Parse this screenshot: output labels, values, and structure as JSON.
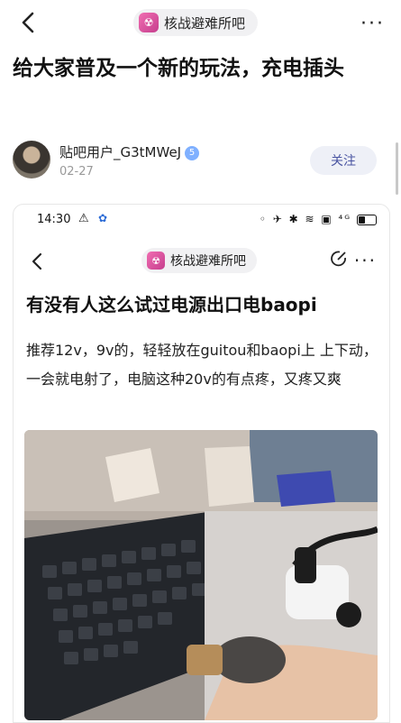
{
  "topbar": {
    "back_icon": "chevron-left-icon",
    "forum_name": "核战避难所吧",
    "forum_icon_glyph": "☢",
    "more_icon": "more-dots-icon",
    "more_glyph": "···"
  },
  "post": {
    "title": "给大家普及一个新的玩法，充电插头"
  },
  "author": {
    "name": "贴吧用户_G3tMWeJ",
    "level_badge": "5",
    "date": "02-27",
    "follow_label": "关注"
  },
  "screenshot": {
    "status_time": "14:30",
    "status_icons": "⚠",
    "status_right": "◦ ✈ ✱ ≋ ▣ ⁴ᴳ",
    "forum_name": "核战避难所吧",
    "forum_icon_glyph": "☢",
    "more_glyph": "···",
    "title": "有没有人这么试过电源出口电baopi",
    "body": "推荐12v，9v的，轻轻放在guitou和baopi上 上下动，一会就电射了，电脑这种20v的有点疼，又疼又爽"
  },
  "colors": {
    "accent": "#4a55a2",
    "forum_icon": "#e15aa5",
    "follow_bg": "#eef0f7"
  }
}
